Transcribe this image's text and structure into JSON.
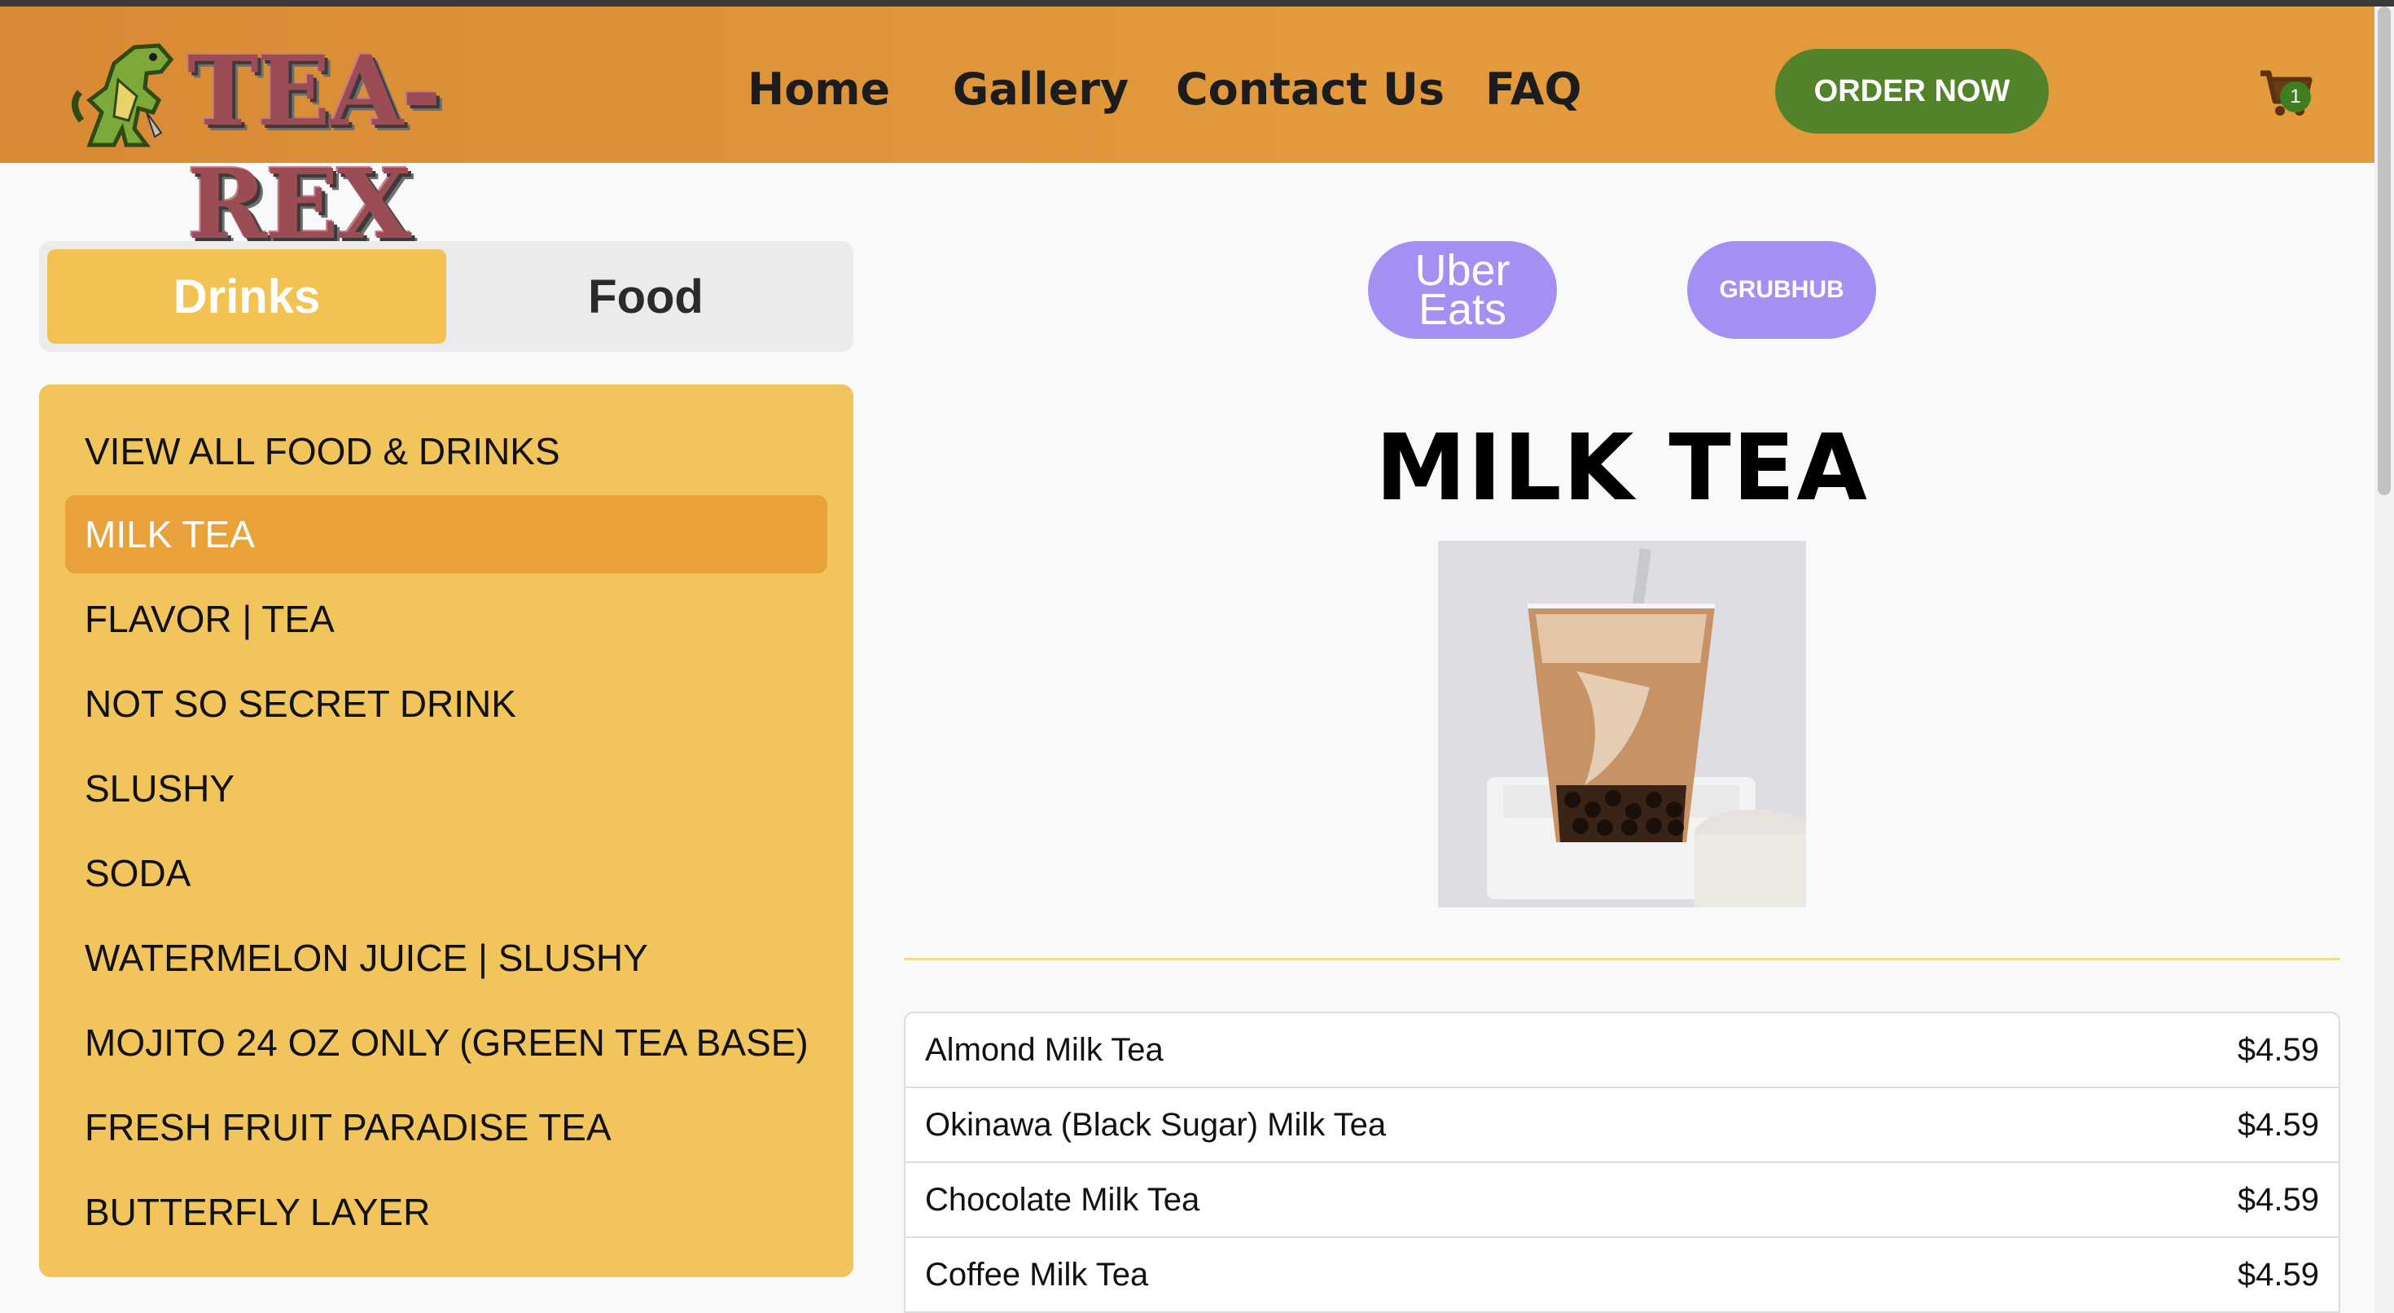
{
  "header": {
    "logo_text": "TEA-REX",
    "nav": [
      "Home",
      "Gallery",
      "Contact Us",
      "FAQ"
    ],
    "order_button": "ORDER NOW",
    "cart_count": "1",
    "background": "#e0933a",
    "order_button_color": "#52832a"
  },
  "tabs": {
    "drinks": "Drinks",
    "food": "Food",
    "active": "Drinks"
  },
  "menu": {
    "items": [
      "VIEW ALL FOOD & DRINKS",
      "MILK TEA",
      "FLAVOR | TEA",
      "NOT SO SECRET DRINK",
      "SLUSHY",
      "SODA",
      "WATERMELON JUICE | SLUSHY",
      "MOJITO 24 OZ ONLY (GREEN TEA BASE)",
      "FRESH FRUIT PARADISE TEA",
      "BUTTERFLY LAYER"
    ],
    "active_item": "MILK TEA",
    "panel_color": "#f2c55c",
    "active_color": "#e9a13c"
  },
  "delivery": {
    "uber_line1": "Uber",
    "uber_line2": "Eats",
    "grubhub": "GRUBHUB",
    "button_color": "#a58ff2"
  },
  "section": {
    "title": "MILK TEA",
    "items": [
      {
        "name": "Almond Milk Tea",
        "price": "$4.59"
      },
      {
        "name": "Okinawa (Black Sugar) Milk Tea",
        "price": "$4.59"
      },
      {
        "name": "Chocolate Milk Tea",
        "price": "$4.59"
      },
      {
        "name": "Coffee Milk Tea",
        "price": "$4.59"
      }
    ]
  },
  "icons": {
    "cart": "shopping-cart-icon",
    "logo": "dinosaur-logo-icon"
  }
}
